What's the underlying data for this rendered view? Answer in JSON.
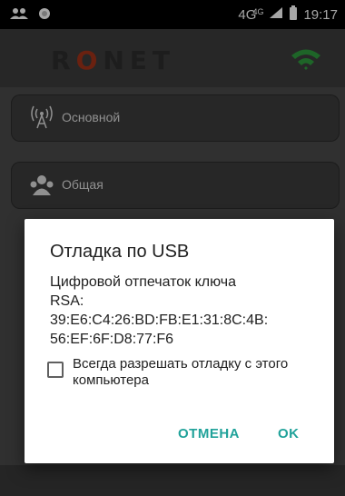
{
  "status_bar": {
    "network": "4G",
    "network_small": "4G",
    "time": "19:17"
  },
  "app": {
    "logo_prefix": "R",
    "logo_o": "O",
    "logo_suffix": "NET",
    "menu_items": [
      {
        "label": "Основной",
        "icon": "antenna-icon"
      },
      {
        "label": "Общая",
        "icon": "group-icon"
      }
    ]
  },
  "dialog": {
    "title": "Отладка по USB",
    "message_line1": "Цифровой отпечаток ключа",
    "message_line2": "RSA:",
    "message_line3": "39:E6:C4:26:BD:FB:E1:31:8C:4B:",
    "message_line4": "56:EF:6F:D8:77:F6",
    "checkbox_label": "Всегда разрешать отладку с этого компьютера",
    "checkbox_checked": false,
    "cancel_label": "ОТМЕНА",
    "ok_label": "OK"
  },
  "colors": {
    "accent": "#20a29a",
    "logo_o": "#a3331a",
    "wifi": "#2e9b3e"
  }
}
